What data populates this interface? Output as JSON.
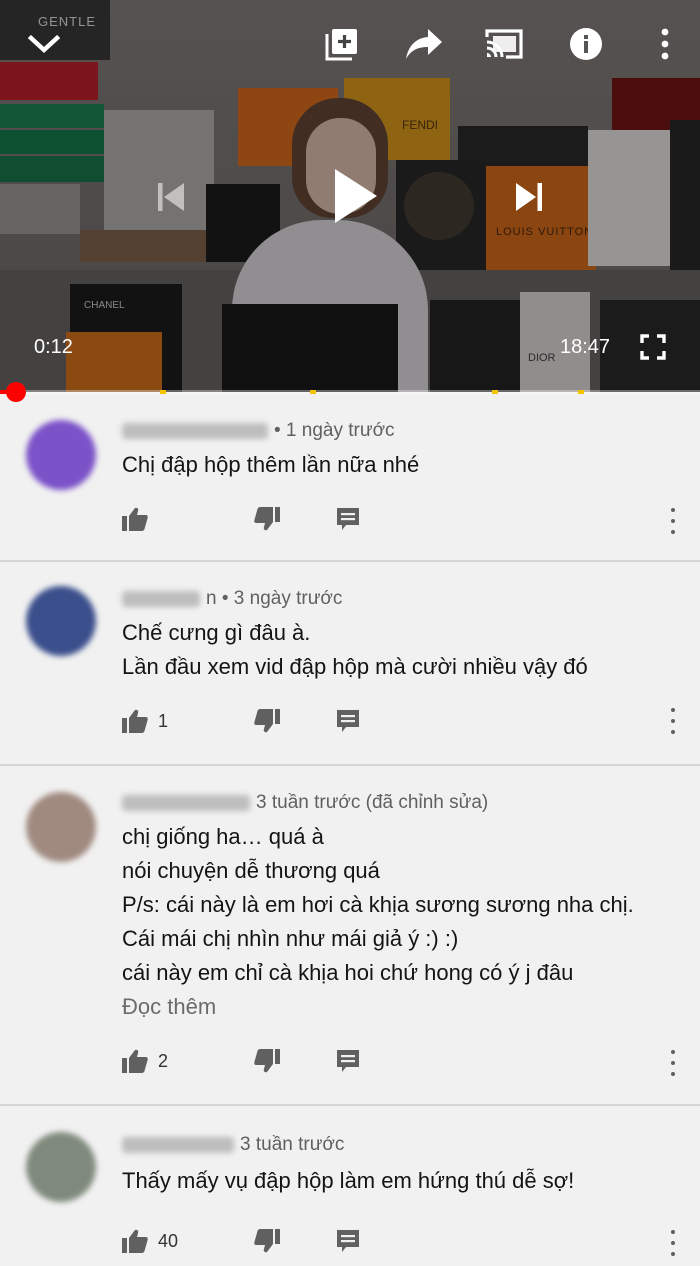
{
  "player": {
    "current_time": "0:12",
    "duration": "18:47",
    "progress_fraction": 0.011,
    "scene_labels": {
      "gentle": "GENTLE",
      "fendi": "FENDI",
      "louis_vuitton": "LOUIS VUITTON",
      "chanel": "CHANEL",
      "dior": "DIOR"
    },
    "icons": {
      "collapse": "chevron-down-icon",
      "add_to_playlist": "add-to-playlist-icon",
      "share": "share-icon",
      "cast": "cast-icon",
      "info": "info-icon",
      "menu": "more-vert-icon",
      "previous": "previous-icon",
      "play": "play-icon",
      "next": "next-icon",
      "fullscreen": "fullscreen-icon"
    }
  },
  "comments": [
    {
      "time": "• 1 ngày trước",
      "lines": [
        "Chị  đập hộp thêm lần nữa nhé"
      ],
      "likes": "",
      "avatar_color": "#7b52c8"
    },
    {
      "time": "n • 3 ngày trước",
      "lines": [
        "Chế cưng gì đâu à.",
        "Lần đầu xem vid đập hộp mà cười nhiều vậy đó"
      ],
      "likes": "1",
      "avatar_color": "#3b4f8c"
    },
    {
      "time": "3 tuần trước (đã chỉnh sửa)",
      "lines": [
        "chị giống ha… quá à",
        "nói chuyện dễ thương quá",
        "P/s: cái này là em hơi cà khịa sương sương nha chị.",
        "Cái mái chị nhìn như mái giả ý :) :)",
        "cái này em chỉ cà khịa hoi chứ hong có ý j đâu"
      ],
      "read_more": "Đọc thêm",
      "likes": "2",
      "avatar_color": "#a08a80"
    },
    {
      "time": "3 tuần trước",
      "lines": [
        "Thấy mấy vụ đập hộp làm em hứng thú dễ sợ!"
      ],
      "likes": "40",
      "avatar_color": "#7f8a7c"
    }
  ],
  "colors": {
    "progress": "#ff0000",
    "ad_marker": "#f5c400",
    "background": "#f1f1f1",
    "divider": "#d6d6d6"
  }
}
